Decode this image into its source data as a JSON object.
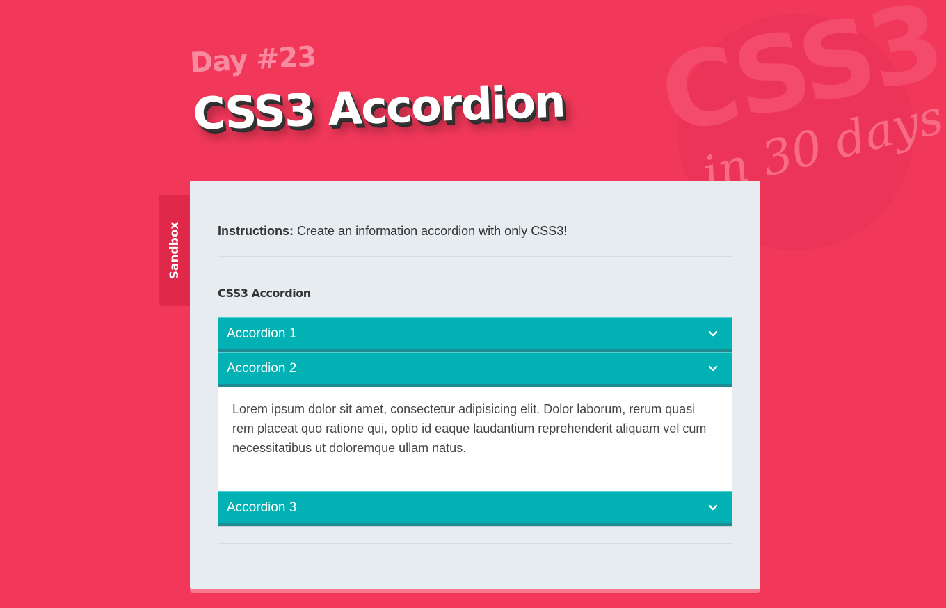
{
  "header": {
    "day_label": "Day #23",
    "title": "CSS3 Accordion"
  },
  "background_logo": {
    "big_text": "CSS3",
    "sub_text": "in 30 days"
  },
  "sandbox_tab": {
    "label": "Sandbox"
  },
  "instructions": {
    "label": "Instructions:",
    "text": "Create an information accordion with only CSS3!"
  },
  "section": {
    "title": "CSS3 Accordion"
  },
  "accordion": {
    "items": [
      {
        "label": "Accordion 1",
        "expanded": false,
        "icon": "chevron-down-icon"
      },
      {
        "label": "Accordion 2",
        "expanded": true,
        "icon": "chevron-down-icon",
        "content": "Lorem ipsum dolor sit amet, consectetur adipisicing elit. Dolor laborum, rerum quasi rem placeat quo ratione qui, optio id eaque laudantium reprehenderit aliquam vel cum necessitatibus ut doloremque ullam natus."
      },
      {
        "label": "Accordion 3",
        "expanded": false,
        "icon": "chevron-down-icon"
      }
    ]
  },
  "colors": {
    "background": "#f2385a",
    "card": "#e6ecf0",
    "accordion_header": "#01b1b4",
    "sandbox_tab": "#e0284b"
  }
}
